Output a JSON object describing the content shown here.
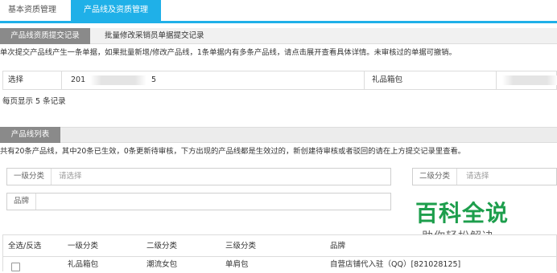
{
  "tabs": {
    "basic": "基本资质管理",
    "product_line": "产品线及资质管理"
  },
  "submit_section": {
    "tab_active": "产品线资质提交记录",
    "tab_batch": "批量修改采销员单据提交记录",
    "notice": "单次提交产品线产生一条单据，如果批量新增/修改产品线，1条单据内有多条产品线，请点击展开查看具体详情。未审核过的单据可撤销。",
    "row": {
      "select": "选择",
      "number_prefix": "201",
      "number_suffix": "5",
      "category": "礼品箱包"
    },
    "pager": "每页显示 5 条记录"
  },
  "list_section": {
    "tab": "产品线列表",
    "summary": "共有20条产品线，其中20条已生效，0条更新待审核，下方出现的产品线都是生效过的，新创建待审核或者驳回的请在上方提交记录里查看。"
  },
  "filters": {
    "level1_label": "一级分类",
    "level1_value": "请选择",
    "level2_label": "二级分类",
    "level2_value": "请选择",
    "brand_label": "品牌"
  },
  "watermark": {
    "title": "百科全说",
    "subtitle": "助你轻松解决"
  },
  "product_table": {
    "headers": [
      "全选/反选",
      "一级分类",
      "二级分类",
      "三级分类",
      "品牌"
    ],
    "rows": [
      {
        "c1": "礼品箱包",
        "c2": "潮流女包",
        "c3": "单肩包",
        "brand": "自营店铺代入驻（QQ）[821028125]"
      }
    ]
  }
}
